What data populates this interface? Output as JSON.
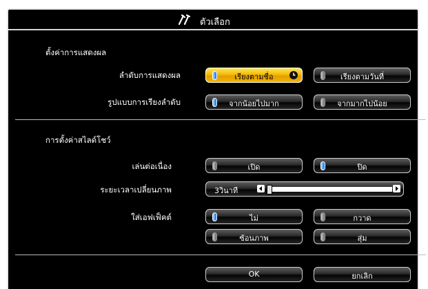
{
  "window": {
    "title": "ตัวเลือก",
    "icon": "tools-icon"
  },
  "display_settings": {
    "section_title": "ตั้งค่าการแสดงผล",
    "display_order": {
      "label": "ลำดับการแสดงผล",
      "options": [
        "เรียงตามชื่อ",
        "เรียงตามวันที่"
      ],
      "selected": "เรียงตามชื่อ"
    },
    "sort_order": {
      "label": "รูปแบบการเรียงลำดับ",
      "options": [
        "จากน้อยไปมาก",
        "จากมากไปน้อย"
      ],
      "selected": "จากน้อยไปมาก"
    }
  },
  "slideshow": {
    "section_title": "การตั้งค่าสไลด์โชว์",
    "continuous": {
      "label": "เล่นต่อเนื่อง",
      "options": [
        "เปิด",
        "ปิด"
      ],
      "selected": "ปิด"
    },
    "interval": {
      "label": "ระยะเวลาเปลี่ยนภาพ",
      "value": "3วินาที"
    },
    "effect": {
      "label": "ใส่เอฟเฟ็คต์",
      "options": [
        "ไม่",
        "กวาด",
        "ซ้อนภาพ",
        "สุ่ม"
      ],
      "selected": "ไม่"
    }
  },
  "actions": {
    "ok": "OK",
    "cancel": "ยกเลิก"
  },
  "colors": {
    "highlight": "#f2b800",
    "toggle_on": "#0d6ff2",
    "panel_bg": "#000000"
  }
}
